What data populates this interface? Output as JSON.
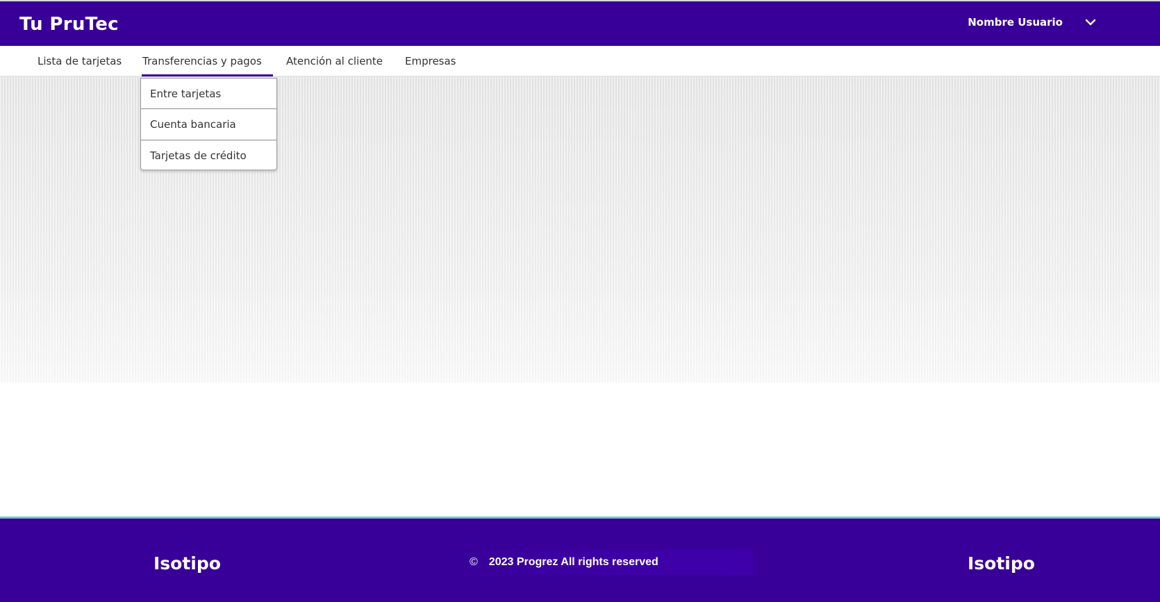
{
  "header": {
    "brand": "Tu PruTec",
    "user_name": "Nombre Usuario",
    "user_menu_icon": "chevron-down-icon"
  },
  "nav": {
    "items": [
      {
        "label": "Lista de tarjetas"
      },
      {
        "label": "Transferencias y pagos",
        "active": true
      },
      {
        "label": "Atención al cliente"
      },
      {
        "label": "Empresas"
      }
    ]
  },
  "dropdown": {
    "items": [
      {
        "label": "Entre tarjetas"
      },
      {
        "label": "Cuenta bancaria"
      },
      {
        "label": "Tarjetas de crédito"
      }
    ]
  },
  "footer": {
    "left_logo": "Isotipo",
    "copyright_symbol": "©",
    "copyright_text": "2023 Progrez All rights reserved",
    "right_logo": "Isotipo"
  },
  "colors": {
    "brand_primary": "#390099",
    "footer_accent": "#6fc7c9"
  }
}
